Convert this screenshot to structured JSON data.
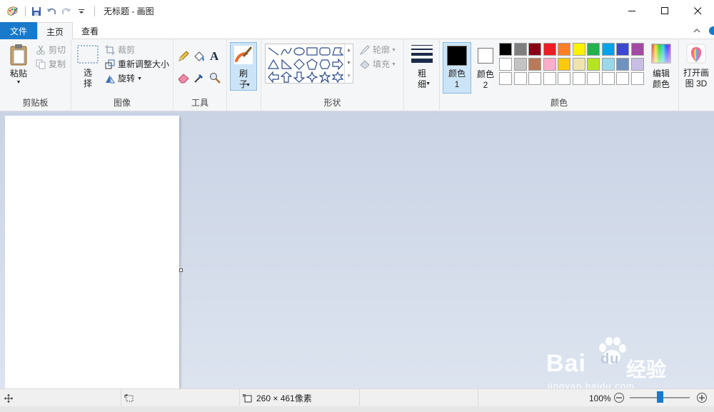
{
  "window": {
    "title": "无标题 - 画图"
  },
  "tabs": {
    "file": "文件",
    "home": "主页",
    "view": "查看"
  },
  "clipboard": {
    "paste": "粘贴",
    "cut": "剪切",
    "copy": "复制",
    "label": "剪贴板"
  },
  "image": {
    "select": "选择",
    "crop": "裁剪",
    "resize": "重新调整大小",
    "rotate": "旋转",
    "label": "图像"
  },
  "tools": {
    "label": "工具",
    "text_glyph": "A"
  },
  "brushes": {
    "label": "刷子"
  },
  "shapes": {
    "outline": "轮廓",
    "fill": "填充",
    "label": "形状"
  },
  "size": {
    "label": "粗细"
  },
  "colors": {
    "color1": "颜色 1",
    "color2": "颜色 2",
    "edit": "编辑颜色",
    "label": "颜色",
    "color1_value": "#000000",
    "color2_value": "#ffffff",
    "palette_row1": [
      "#000000",
      "#7f7f7f",
      "#880015",
      "#ed1c24",
      "#ff7f27",
      "#fff200",
      "#22b14c",
      "#00a2e8",
      "#3f48cc",
      "#a349a4"
    ],
    "palette_row2": [
      "#ffffff",
      "#c3c3c3",
      "#b97a57",
      "#ffaec9",
      "#ffc90e",
      "#efe4b0",
      "#b5e61d",
      "#99d9ea",
      "#7092be",
      "#c8bfe7"
    ],
    "palette_row3": [
      "#ffffff",
      "#ffffff",
      "#ffffff",
      "#ffffff",
      "#ffffff",
      "#ffffff",
      "#ffffff",
      "#ffffff",
      "#ffffff",
      "#ffffff"
    ]
  },
  "paint3d": {
    "label": "打开画图 3D"
  },
  "status": {
    "dimensions": "260 × 461像素",
    "zoom": "100%",
    "zoom_fraction": 0.5
  },
  "watermark": {
    "brand": "Bai",
    "brand2": "du",
    "cn": "经验",
    "url": "jingyan.baidu.com"
  }
}
